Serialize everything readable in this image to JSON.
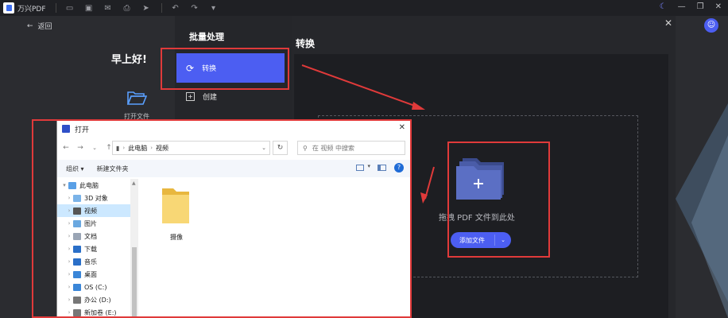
{
  "titlebar": {
    "app_name": "万兴PDF",
    "icons": [
      "folder-icon",
      "save-icon",
      "mail-icon",
      "print-icon",
      "share-icon",
      "undo-icon",
      "redo-icon",
      "dropdown-icon"
    ],
    "controls": [
      "moon-icon",
      "minimize-icon",
      "restore-icon",
      "close-icon"
    ]
  },
  "left": {
    "back_label": "返回",
    "greeting": "早上好!",
    "open_file_label": "打开文件"
  },
  "nav": {
    "title": "批量处理",
    "items": [
      {
        "label": "转换",
        "icon": "convert-icon",
        "selected": true
      },
      {
        "label": "创建",
        "icon": "create-icon",
        "selected": false
      }
    ]
  },
  "main": {
    "title": "转换",
    "drop_label": "拖拽 PDF 文件到此处",
    "add_button": "添加文件",
    "avatar_icon": "user-icon"
  },
  "dialog": {
    "title": "打开",
    "path": [
      "此电脑",
      "视频"
    ],
    "search_placeholder": "在 视频 中搜索",
    "toolbar": {
      "organize": "组织 ▾",
      "new_folder": "新建文件夹"
    },
    "tree": [
      {
        "label": "此电脑",
        "expand": "▾",
        "indent": 0,
        "color": "#5aa0e6"
      },
      {
        "label": "3D 对象",
        "expand": "›",
        "indent": 1,
        "color": "#7ab3e8"
      },
      {
        "label": "视频",
        "expand": "›",
        "indent": 1,
        "color": "#555555",
        "selected": true
      },
      {
        "label": "图片",
        "expand": "›",
        "indent": 1,
        "color": "#6aa8e0"
      },
      {
        "label": "文档",
        "expand": "›",
        "indent": 1,
        "color": "#9aa5b5"
      },
      {
        "label": "下载",
        "expand": "›",
        "indent": 1,
        "color": "#2a6fc8"
      },
      {
        "label": "音乐",
        "expand": "›",
        "indent": 1,
        "color": "#2a6fc8"
      },
      {
        "label": "桌面",
        "expand": "›",
        "indent": 1,
        "color": "#3a86d8"
      },
      {
        "label": "OS (C:)",
        "expand": "›",
        "indent": 1,
        "color": "#3a86d8"
      },
      {
        "label": "办公 (D:)",
        "expand": "›",
        "indent": 1,
        "color": "#777777"
      },
      {
        "label": "新加卷 (E:)",
        "expand": "›",
        "indent": 1,
        "color": "#777777"
      }
    ],
    "files": [
      {
        "name": "摄像",
        "type": "folder"
      }
    ]
  }
}
